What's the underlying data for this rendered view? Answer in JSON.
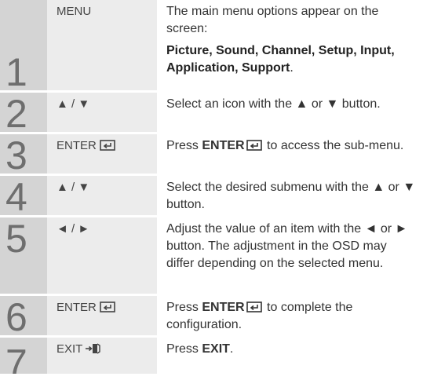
{
  "steps": [
    {
      "number": "1",
      "key": "MENU",
      "desc": "The main menu options appear on the screen:",
      "emphasis": "Picture, Sound, Channel, Setup, Input, Application, Support",
      "emphasis_suffix": "."
    },
    {
      "number": "2",
      "key": "▲ / ▼",
      "desc": "Select an icon with the ▲ or ▼ button."
    },
    {
      "number": "3",
      "key": "ENTER",
      "desc_pre": "Press ",
      "desc_bold": "ENTER",
      "desc_post": " to access the sub-menu."
    },
    {
      "number": "4",
      "key": "▲ / ▼",
      "desc": "Select the desired submenu with the ▲ or ▼ button."
    },
    {
      "number": "5",
      "key": "◄ / ►",
      "desc": "Adjust the value of an item with the ◄ or ► button. The adjustment in the OSD may differ depending on the selected menu."
    },
    {
      "number": "6",
      "key": "ENTER",
      "desc_pre": "Press ",
      "desc_bold": "ENTER",
      "desc_post": " to complete the configuration."
    },
    {
      "number": "7",
      "key": "EXIT",
      "desc_pre": "Press ",
      "desc_bold": "EXIT",
      "desc_post": "."
    }
  ]
}
